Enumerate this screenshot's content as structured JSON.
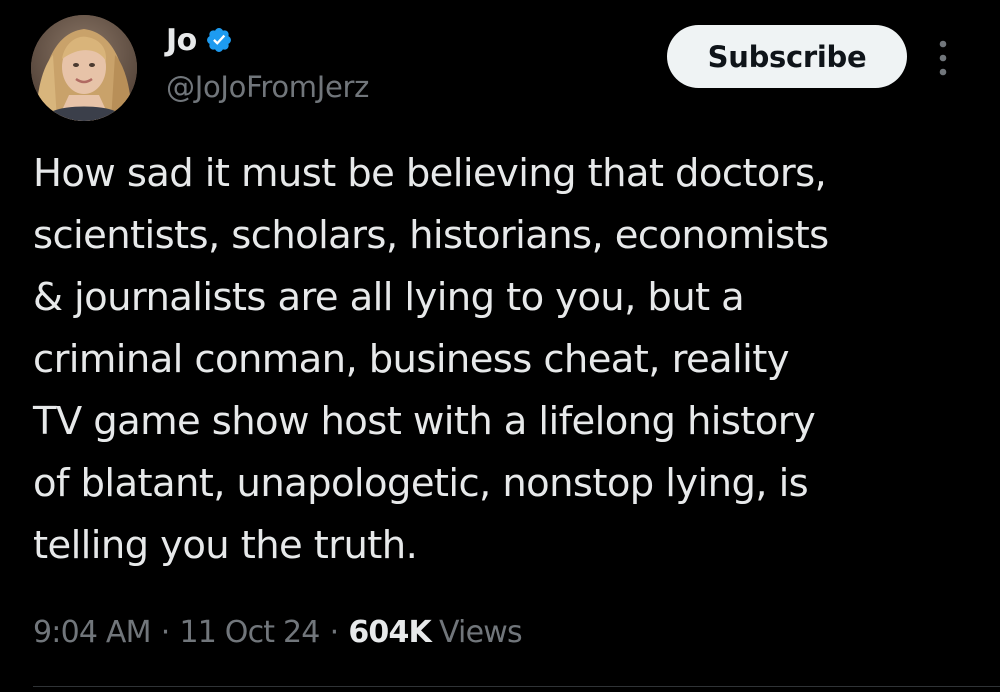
{
  "author": {
    "display_name": "Jo",
    "handle": "@JoJoFromJerz",
    "verified": true,
    "verified_icon": "verified-badge-icon",
    "verified_color": "#1d9bf0"
  },
  "actions": {
    "subscribe_label": "Subscribe",
    "more_icon": "more-vertical-icon"
  },
  "tweet": {
    "text": "How sad it must be believing that doctors,\nscientists, scholars, historians, economists\n& journalists are all lying to you, but a\ncriminal conman, business cheat, reality\nTV game show host with a lifelong history\nof blatant, unapologetic, nonstop lying, is\ntelling you the truth."
  },
  "meta": {
    "time": "9:04 AM",
    "separator": "·",
    "date": "11 Oct 24",
    "views_count": "604K",
    "views_label": "Views"
  },
  "colors": {
    "background": "#000000",
    "primary_text": "#e7e9ea",
    "secondary_text": "#71767b",
    "button_bg": "#eff3f4",
    "button_text": "#0f1419",
    "divider": "#2f3336"
  }
}
